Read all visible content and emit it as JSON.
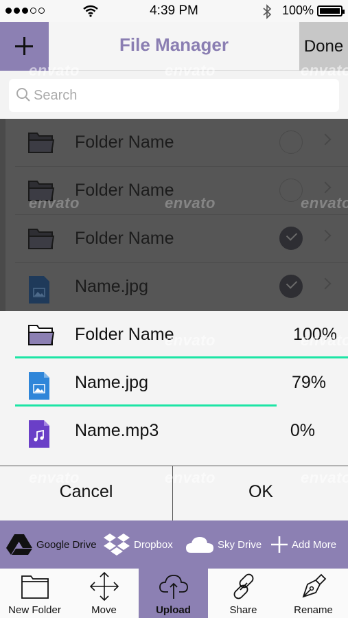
{
  "status_bar": {
    "time": "4:39 PM",
    "battery_pct": "100%",
    "signal_dots_on": 3,
    "signal_dots_total": 5,
    "icons": [
      "signal-dots-icon",
      "wifi-icon",
      "bluetooth-icon",
      "battery-icon"
    ]
  },
  "navbar": {
    "title": "File Manager",
    "done_label": "Done",
    "add_icon": "plus-icon"
  },
  "search": {
    "placeholder": "Search",
    "icon": "search-icon"
  },
  "file_list": [
    {
      "name": "Folder Name",
      "type": "folder",
      "checked": false
    },
    {
      "name": "Folder Name",
      "type": "folder",
      "checked": false
    },
    {
      "name": "Folder Name",
      "type": "folder",
      "checked": true
    },
    {
      "name": "Name.jpg",
      "type": "image",
      "checked": true
    }
  ],
  "upload_list": [
    {
      "name": "Folder Name",
      "type": "folder",
      "pct": "100%",
      "progress": 1.0
    },
    {
      "name": "Name.jpg",
      "type": "image",
      "pct": "79%",
      "progress": 0.79
    },
    {
      "name": "Name.mp3",
      "type": "audio",
      "pct": "0%",
      "progress": 0
    }
  ],
  "dialog": {
    "cancel_label": "Cancel",
    "ok_label": "OK"
  },
  "services": [
    {
      "label": "Google Drive",
      "icon": "google-drive-icon"
    },
    {
      "label": "Dropbox",
      "icon": "dropbox-icon"
    },
    {
      "label": "Sky Drive",
      "icon": "cloud-icon"
    },
    {
      "label": "Add More",
      "icon": "plus-icon"
    }
  ],
  "toolbar": [
    {
      "label": "New Folder",
      "icon": "folder-icon",
      "active": false
    },
    {
      "label": "Move",
      "icon": "move-arrows-icon",
      "active": false
    },
    {
      "label": "Upload",
      "icon": "cloud-upload-icon",
      "active": true
    },
    {
      "label": "Share",
      "icon": "link-icon",
      "active": false
    },
    {
      "label": "Rename",
      "icon": "pen-nib-icon",
      "active": false
    }
  ],
  "watermark": "envato",
  "colors": {
    "accent": "#8c80b3",
    "title": "#8a7eb2",
    "progress": "#1de5a5",
    "image_file": "#2f86d9",
    "audio_file": "#6a3fc7"
  }
}
